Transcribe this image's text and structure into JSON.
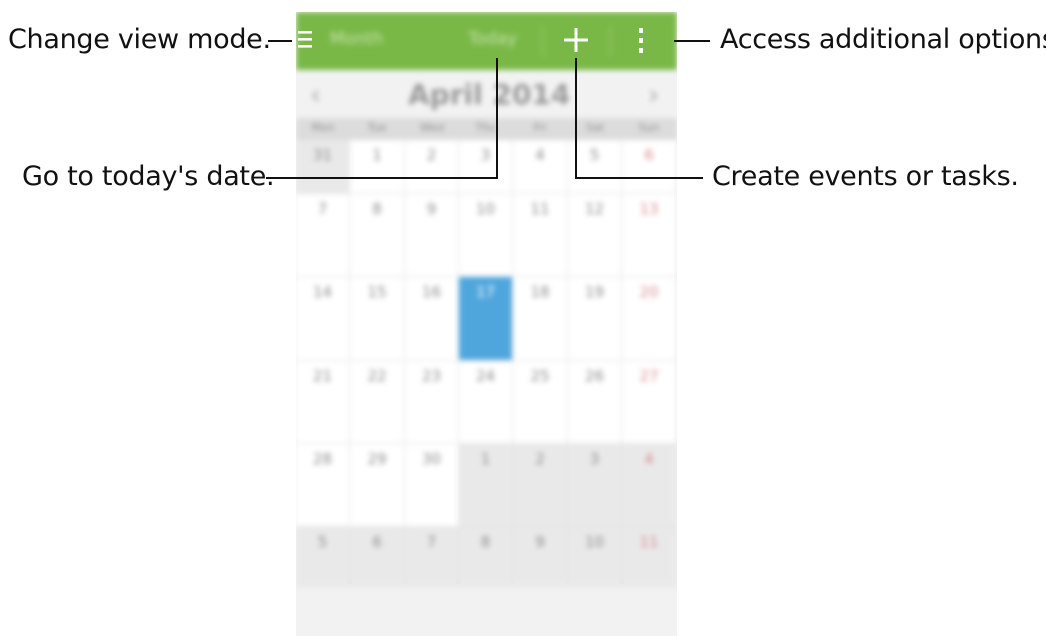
{
  "callouts": {
    "view_mode": "Change view mode.",
    "today": "Go to today's date.",
    "options": "Access additional options.",
    "create": "Create events or tasks."
  },
  "app": {
    "actionbar": {
      "view_mode_label": "Month",
      "today_label": "Today",
      "add_icon": "plus-icon",
      "menu_icon": "hamburger-icon",
      "more_icon": "overflow-menu-icon",
      "color": "#79b847"
    },
    "month": {
      "title": "April 2014",
      "prev": "‹",
      "next": "›"
    },
    "weekdays": [
      "Mon",
      "Tue",
      "Wed",
      "Thu",
      "Fri",
      "Sat",
      "Sun"
    ],
    "weeks": [
      [
        "31",
        "1",
        "2",
        "3",
        "4",
        "5",
        "6"
      ],
      [
        "7",
        "8",
        "9",
        "10",
        "11",
        "12",
        "13"
      ],
      [
        "14",
        "15",
        "16",
        "17",
        "18",
        "19",
        "20"
      ],
      [
        "21",
        "22",
        "23",
        "24",
        "25",
        "26",
        "27"
      ],
      [
        "28",
        "29",
        "30",
        "1",
        "2",
        "3",
        "4"
      ],
      [
        "5",
        "6",
        "7",
        "8",
        "9",
        "10",
        "11"
      ]
    ],
    "selected_date": "17",
    "accent_selected": "#4fa6dd"
  }
}
